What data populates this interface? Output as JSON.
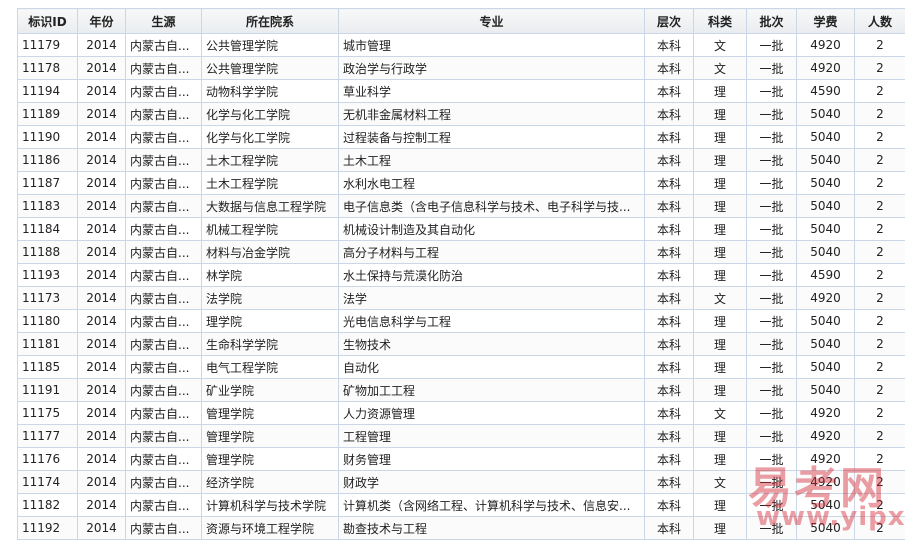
{
  "table": {
    "headers": [
      "标识ID",
      "年份",
      "生源",
      "所在院系",
      "专业",
      "层次",
      "科类",
      "批次",
      "学费",
      "人数"
    ],
    "rows": [
      [
        "11179",
        "2014",
        "内蒙古自...",
        "公共管理学院",
        "城市管理",
        "本科",
        "文",
        "一批",
        "4920",
        "2"
      ],
      [
        "11178",
        "2014",
        "内蒙古自...",
        "公共管理学院",
        "政治学与行政学",
        "本科",
        "文",
        "一批",
        "4920",
        "2"
      ],
      [
        "11194",
        "2014",
        "内蒙古自...",
        "动物科学学院",
        "草业科学",
        "本科",
        "理",
        "一批",
        "4590",
        "2"
      ],
      [
        "11189",
        "2014",
        "内蒙古自...",
        "化学与化工学院",
        "无机非金属材料工程",
        "本科",
        "理",
        "一批",
        "5040",
        "2"
      ],
      [
        "11190",
        "2014",
        "内蒙古自...",
        "化学与化工学院",
        "过程装备与控制工程",
        "本科",
        "理",
        "一批",
        "5040",
        "2"
      ],
      [
        "11186",
        "2014",
        "内蒙古自...",
        "土木工程学院",
        "土木工程",
        "本科",
        "理",
        "一批",
        "5040",
        "2"
      ],
      [
        "11187",
        "2014",
        "内蒙古自...",
        "土木工程学院",
        "水利水电工程",
        "本科",
        "理",
        "一批",
        "5040",
        "2"
      ],
      [
        "11183",
        "2014",
        "内蒙古自...",
        "大数据与信息工程学院",
        "电子信息类（含电子信息科学与技术、电子科学与技...",
        "本科",
        "理",
        "一批",
        "5040",
        "2"
      ],
      [
        "11184",
        "2014",
        "内蒙古自...",
        "机械工程学院",
        "机械设计制造及其自动化",
        "本科",
        "理",
        "一批",
        "5040",
        "2"
      ],
      [
        "11188",
        "2014",
        "内蒙古自...",
        "材料与冶金学院",
        "高分子材料与工程",
        "本科",
        "理",
        "一批",
        "5040",
        "2"
      ],
      [
        "11193",
        "2014",
        "内蒙古自...",
        "林学院",
        "水土保持与荒漠化防治",
        "本科",
        "理",
        "一批",
        "4590",
        "2"
      ],
      [
        "11173",
        "2014",
        "内蒙古自...",
        "法学院",
        "法学",
        "本科",
        "文",
        "一批",
        "4920",
        "2"
      ],
      [
        "11180",
        "2014",
        "内蒙古自...",
        "理学院",
        "光电信息科学与工程",
        "本科",
        "理",
        "一批",
        "5040",
        "2"
      ],
      [
        "11181",
        "2014",
        "内蒙古自...",
        "生命科学学院",
        "生物技术",
        "本科",
        "理",
        "一批",
        "5040",
        "2"
      ],
      [
        "11185",
        "2014",
        "内蒙古自...",
        "电气工程学院",
        "自动化",
        "本科",
        "理",
        "一批",
        "5040",
        "2"
      ],
      [
        "11191",
        "2014",
        "内蒙古自...",
        "矿业学院",
        "矿物加工工程",
        "本科",
        "理",
        "一批",
        "5040",
        "2"
      ],
      [
        "11175",
        "2014",
        "内蒙古自...",
        "管理学院",
        "人力资源管理",
        "本科",
        "文",
        "一批",
        "4920",
        "2"
      ],
      [
        "11177",
        "2014",
        "内蒙古自...",
        "管理学院",
        "工程管理",
        "本科",
        "理",
        "一批",
        "4920",
        "2"
      ],
      [
        "11176",
        "2014",
        "内蒙古自...",
        "管理学院",
        "财务管理",
        "本科",
        "理",
        "一批",
        "4920",
        "2"
      ],
      [
        "11174",
        "2014",
        "内蒙古自...",
        "经济学院",
        "财政学",
        "本科",
        "文",
        "一批",
        "4920",
        "2"
      ],
      [
        "11182",
        "2014",
        "内蒙古自...",
        "计算机科学与技术学院",
        "计算机类（含网络工程、计算机科学与技术、信息安...",
        "本科",
        "理",
        "一批",
        "5040",
        "2"
      ],
      [
        "11192",
        "2014",
        "内蒙古自...",
        "资源与环境工程学院",
        "勘查技术与工程",
        "本科",
        "理",
        "一批",
        "5040",
        "2"
      ]
    ]
  },
  "watermark": {
    "top_text": "易考网",
    "bottom_text": "www.yipx.com"
  },
  "colors": {
    "border": "#c9d7e6",
    "watermark": "#d22832"
  }
}
